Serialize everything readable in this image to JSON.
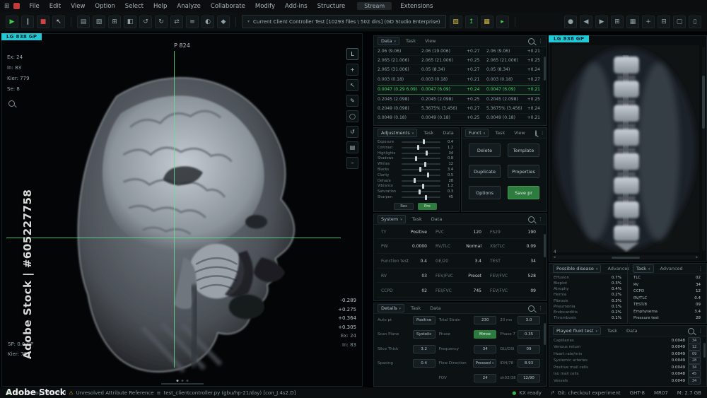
{
  "colors": {
    "accent_cyan": "#1fc9d6",
    "accent_green": "#3fae4f",
    "accent_red": "#d24444",
    "accent_yellow": "#d9b83e",
    "highlight_green": "#49d26c"
  },
  "watermark": {
    "vertical": "Adobe Stock | #605227758",
    "corner": "Adobe Stock"
  },
  "menubar": {
    "items": [
      "File",
      "Edit",
      "View",
      "Option",
      "Select",
      "Help",
      "Analyze",
      "Collaborate",
      "Modify",
      "Add-ins",
      "Structure"
    ],
    "chip": "Stream",
    "right_item": "Extensions"
  },
  "toolbar": {
    "transport": [
      {
        "name": "play-icon",
        "glyph": "▶",
        "color": "#3ecf4e"
      },
      {
        "name": "pause-icon",
        "glyph": "∥",
        "color": "#9fb0b5"
      },
      {
        "name": "stop-icon",
        "glyph": "■",
        "color": "#d24444"
      },
      {
        "name": "cursor-icon",
        "glyph": "↖",
        "color": "#cfd9dc"
      }
    ],
    "mid_icons": [
      {
        "name": "save-icon",
        "glyph": "▤"
      },
      {
        "name": "folder-icon",
        "glyph": "▨"
      },
      {
        "name": "grid-icon",
        "glyph": "⊞"
      },
      {
        "name": "layout-icon",
        "glyph": "◧"
      },
      {
        "name": "undo-icon",
        "glyph": "↺"
      },
      {
        "name": "redo-icon",
        "glyph": "↻"
      },
      {
        "name": "swap-icon",
        "glyph": "⇄"
      },
      {
        "name": "list-icon",
        "glyph": "≡"
      },
      {
        "name": "contrast-icon",
        "glyph": "◐"
      },
      {
        "name": "diamond-icon",
        "glyph": "◆"
      }
    ],
    "dropdown": {
      "label": "Current Client Controller Test [10293 files \\ 502 dirs] (GD Studio Enterprise)"
    },
    "colored_icons": [
      {
        "name": "new-file-icon",
        "glyph": "▨",
        "color": "#d9b83e"
      },
      {
        "name": "export-icon",
        "glyph": "↥",
        "color": "#3ecf4e"
      },
      {
        "name": "database-icon",
        "glyph": "▦",
        "color": "#d9b83e"
      },
      {
        "name": "run-icon",
        "glyph": "▸",
        "color": "#3ecf4e"
      }
    ],
    "right_icons": [
      {
        "name": "record-icon",
        "glyph": "●"
      },
      {
        "name": "prev-icon",
        "glyph": "◀"
      },
      {
        "name": "next-icon",
        "glyph": "▶"
      },
      {
        "name": "grid2-icon",
        "glyph": "⊞"
      },
      {
        "name": "table-icon",
        "glyph": "▦"
      },
      {
        "name": "add-icon",
        "glyph": "+"
      },
      {
        "name": "remove-icon",
        "glyph": "⊟"
      },
      {
        "name": "frame-icon",
        "glyph": "▢"
      },
      {
        "name": "trash-icon",
        "glyph": "▯"
      }
    ]
  },
  "viewer": {
    "tag": "LG 838 GP",
    "top_label": "P 824",
    "left_labels": [
      "Ex: 24",
      "In: 83",
      "Kier: 779",
      "Se: 8"
    ],
    "tools": [
      {
        "name": "letter-l-tool",
        "glyph": "L"
      },
      {
        "name": "zoom-in-tool",
        "glyph": "+"
      },
      {
        "name": "cursor-tool",
        "glyph": "↖"
      },
      {
        "name": "draw-tool",
        "glyph": "✎"
      },
      {
        "name": "ellipse-tool",
        "glyph": "◯"
      },
      {
        "name": "undo-tool",
        "glyph": "↺"
      },
      {
        "name": "layers-tool",
        "glyph": "▤"
      },
      {
        "name": "zoom-out-tool",
        "glyph": "–"
      }
    ],
    "bottom_right_values": [
      "-0.289",
      "+0.275",
      "+0.364",
      "+0.305"
    ],
    "bottom_right_labels": [
      "Ex: 24",
      "In: 83"
    ],
    "bottom_left_labels": [
      "SP: 0.0 GP",
      "Kier: 779"
    ]
  },
  "data_panel": {
    "tabs": [
      "Data",
      "Task",
      "View"
    ],
    "highlight_row": 4,
    "rows": [
      [
        "2.06 (9.06)",
        "2.06 (19.006)",
        "+0.27",
        "2.06 (9.06)",
        "+0.21"
      ],
      [
        "2.065 (21.006)",
        "2.065 (21.006)",
        "+0.25",
        "2.065 (21.006)",
        "+0.25"
      ],
      [
        "2.065 (31.006)",
        "0.05 (8.34)",
        "+0.27",
        "0.05 (8.34)",
        "+0.24"
      ],
      [
        "0.003 (0.18)",
        "0.003 (0.18)",
        "+0.21",
        "0.003 (0.18)",
        "+0.27"
      ],
      [
        "0.0047 (0.29 6.09)",
        "0.0047 (6.09)",
        "+0.24",
        "0.0047 (6.09)",
        "+0.21"
      ],
      [
        "0.2045 (2.098)",
        "0.2045 (2.098)",
        "+0.25",
        "0.2045 (2.098)",
        "+0.25"
      ],
      [
        "0.2049 (0.098)",
        "5.3675% (3.456)",
        "+0.27",
        "5.3675% (3.456)",
        "+0.24"
      ],
      [
        "0.0049 (0.18)",
        "0.0049 (0.18)",
        "+0.25",
        "0.0049 (0.18)",
        "+0.21"
      ]
    ]
  },
  "adjustments_panel": {
    "tabs": [
      "Adjustments",
      "Task",
      "Data"
    ],
    "sliders": [
      {
        "label": "Exposure",
        "value": "0.4",
        "pos": 55
      },
      {
        "label": "Contrast",
        "value": "1.2",
        "pos": 40
      },
      {
        "label": "Highlights",
        "value": "34",
        "pos": 62
      },
      {
        "label": "Shadows",
        "value": "0.8",
        "pos": 35
      },
      {
        "label": "Whites",
        "value": "12",
        "pos": 58
      },
      {
        "label": "Blacks",
        "value": "3.4",
        "pos": 45
      },
      {
        "label": "Clarity",
        "value": "0.5",
        "pos": 66
      },
      {
        "label": "Dehaze",
        "value": "28",
        "pos": 30
      },
      {
        "label": "Vibrance",
        "value": "1.2",
        "pos": 52
      },
      {
        "label": "Saturation",
        "value": "0.3",
        "pos": 44
      },
      {
        "label": "Sharpen",
        "value": "45",
        "pos": 60
      }
    ],
    "footer_buttons": [
      {
        "label": "Res",
        "style": "dark"
      },
      {
        "label": "Pro",
        "style": "green"
      }
    ]
  },
  "funct_panel": {
    "tabs": [
      "Funct",
      "Task",
      "View"
    ],
    "buttons": [
      {
        "label": "Delete",
        "style": "dark"
      },
      {
        "label": "Template",
        "style": "dark"
      },
      {
        "label": "Duplicate",
        "style": "dark"
      },
      {
        "label": "Properties",
        "style": "dark"
      },
      {
        "label": "Options",
        "style": "dark"
      },
      {
        "label": "Save pr",
        "style": "green"
      }
    ]
  },
  "system_panel": {
    "tabs": [
      "System",
      "Task",
      "Data"
    ],
    "rows": [
      [
        {
          "label": "TY",
          "value": "Positive"
        },
        {
          "label": "PVC",
          "value": "120"
        },
        {
          "label": "FS29",
          "value": "190"
        }
      ],
      [
        {
          "label": "PW",
          "value": "0.0000"
        },
        {
          "label": "RV/TLC",
          "value": "Normal"
        },
        {
          "label": "X9/TLC",
          "value": "0.09"
        }
      ],
      [
        {
          "label": "Function test",
          "value": "0.4"
        },
        {
          "label": "GE/20",
          "value": "3.4"
        },
        {
          "label": "TEST",
          "value": "34"
        }
      ],
      [
        {
          "label": "RV",
          "value": "03"
        },
        {
          "label": "FEV/FVC",
          "value": "Preset"
        },
        {
          "label": "FEV/FVC",
          "value": "528"
        }
      ],
      [
        {
          "label": "CCPD",
          "value": "02"
        },
        {
          "label": "FEI/FVC",
          "value": "745"
        },
        {
          "label": "FEV/FVC",
          "value": "09"
        }
      ]
    ]
  },
  "details_panel": {
    "tabs": [
      "Details",
      "Task",
      "Data"
    ],
    "rows": [
      [
        {
          "label": "Auto pt",
          "value": "Positive"
        },
        {
          "label": "Total Strain",
          "value": "230"
        },
        {
          "label": "20 ms",
          "value": "3.0"
        }
      ],
      [
        {
          "label": "Scan Plane",
          "value": "Systolic"
        },
        {
          "label": "Phase",
          "value": "Mmoc",
          "green": true
        },
        {
          "label": "Phase 7t",
          "value": "0.35"
        }
      ],
      [
        {
          "label": "Slice Thick",
          "value": "3.2"
        },
        {
          "label": "Frequency",
          "value": "34"
        },
        {
          "label": "GLI/DSI",
          "value": "09"
        }
      ],
      [
        {
          "label": "Spacing",
          "value": "0.4"
        },
        {
          "label": "Flow Direction",
          "value": "Pressed",
          "caret": true
        },
        {
          "label": "IDH/78",
          "value": "8.93"
        }
      ],
      [
        null,
        {
          "label": "FOV",
          "value": "24"
        },
        {
          "label": "sh02(38)",
          "value": "12/90"
        }
      ]
    ]
  },
  "spine_panel": {
    "tag": "LG 838 GP",
    "page_label": "4"
  },
  "disease_panel": {
    "tabs": [
      "Possible disease",
      "Advanced"
    ],
    "items": [
      {
        "label": "Effusion",
        "value": "0.7%"
      },
      {
        "label": "Bleplot",
        "value": "0.3%"
      },
      {
        "label": "Atrophy",
        "value": "0.4%"
      },
      {
        "label": "Hernia",
        "value": "0.2%"
      },
      {
        "label": "Fibrosis",
        "value": "0.3%"
      },
      {
        "label": "Pneumonia",
        "value": "0.1%"
      },
      {
        "label": "Endocarditis",
        "value": "0.2%"
      },
      {
        "label": "Thrombosis",
        "value": "0.1%"
      }
    ]
  },
  "task_panel": {
    "tabs": [
      "Task",
      "Advanced"
    ],
    "items": [
      {
        "label": "TLC",
        "value": "02"
      },
      {
        "label": "RV",
        "value": "34"
      },
      {
        "label": "CCPD",
        "value": "12"
      },
      {
        "label": "RV/TLC",
        "value": "0.4"
      },
      {
        "label": "TEST/8",
        "value": "09"
      },
      {
        "label": "Emphysema",
        "value": "3.4"
      },
      {
        "label": "Pressure test",
        "value": "28"
      }
    ]
  },
  "fluid_panel": {
    "tabs": [
      "Played fluid test",
      "Task",
      "Data"
    ],
    "rows": [
      {
        "label": "Capillaries",
        "value": "0.0048",
        "mini": "34"
      },
      {
        "label": "Venous return",
        "value": "0.0049",
        "mini": "12"
      },
      {
        "label": "Heart rate/min",
        "value": "0.0049",
        "mini": "09"
      },
      {
        "label": "Systemic arteries",
        "value": "0.0049",
        "mini": "28"
      },
      {
        "label": "Positive mail cells",
        "value": "0.0049",
        "mini": "34"
      },
      {
        "label": "Iso mail cells",
        "value": "0.0048",
        "mini": "45"
      },
      {
        "label": "Vessels",
        "value": "0.0049",
        "mini": "34"
      }
    ]
  },
  "statusbar": {
    "left": [
      {
        "name": "status-app",
        "icon": "▣",
        "icon_color": "#3fae4f",
        "icon_name": "app-status-icon",
        "text": "Microbiolog [Mori PH]"
      },
      {
        "name": "status-warning",
        "icon": "⚠",
        "icon_color": "#d9b83e",
        "icon_name": "warning-icon",
        "text": "Unresolved Attribute Reference"
      },
      {
        "name": "status-file",
        "icon": "≡",
        "icon_color": "#7e9096",
        "icon_name": "file-icon",
        "text": "test_clientcontroller.py (gbu/hp-21/day) [con_J.4s2.D]"
      }
    ],
    "right": [
      {
        "name": "status-ready",
        "icon": "●",
        "icon_color": "#3fae4f",
        "icon_name": "ready-dot-icon",
        "text": "KX ready"
      },
      {
        "name": "status-git",
        "icon": "↱",
        "icon_color": "#8698a0",
        "icon_name": "git-branch-icon",
        "text": "Git: checkout experiment"
      },
      {
        "name": "status-ght",
        "icon": null,
        "icon_name": null,
        "text": "GHT-8"
      },
      {
        "name": "status-mr",
        "icon": null,
        "icon_name": null,
        "text": "MR07"
      },
      {
        "name": "status-mem",
        "icon": null,
        "icon_name": null,
        "text": "M: 2.7 GB"
      }
    ]
  }
}
